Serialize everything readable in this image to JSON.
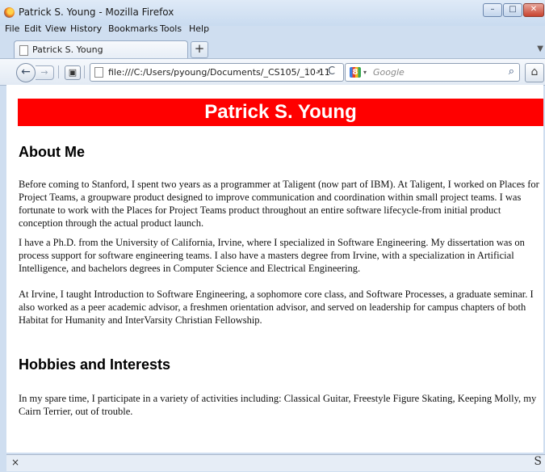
{
  "window": {
    "title": "Patrick S. Young - Mozilla Firefox",
    "controls": {
      "minimize": "–",
      "maximize": "□",
      "close": "✕"
    }
  },
  "menubar": [
    "File",
    "Edit",
    "View",
    "History",
    "Bookmarks",
    "Tools",
    "Help"
  ],
  "tab": {
    "label": "Patrick S. Young",
    "new_tab": "+",
    "scroll": "▼"
  },
  "nav": {
    "back": "←",
    "forward": "→",
    "panorama": "▣",
    "url": "file:///C:/Users/pyoung/Documents/_CS105/_10-11",
    "star": "☆",
    "dropdown": "▾",
    "reload": "C",
    "search_engine": "8",
    "search_dropdown": "▾",
    "search_placeholder": "Google",
    "search_button": "⌕",
    "home": "⌂"
  },
  "page": {
    "heading": "Patrick S. Young",
    "section1_title": "About Me",
    "para1": "Before coming to Stanford, I spent two years as a programmer at Taligent (now part of IBM). At Taligent, I worked on Places for Project Teams, a groupware product designed to improve communication and coordination within small project teams. I was fortunate to work with the Places for Project Teams product throughout an entire software lifecycle-from initial product conception through the actual product launch.",
    "para2": "I have a Ph.D. from the University of California, Irvine, where I specialized in Software Engineering. My dissertation was on process support for software engineering teams. I also have a masters degree from Irvine, with a specialization in Artificial Intelligence, and bachelors degrees in Computer Science and Electrical Engineering.",
    "para3": "At Irvine, I taught Introduction to Software Engineering, a sophomore core class, and Software Processes, a graduate seminar. I also worked as a peer academic advisor, a freshmen orientation advisor, and served on leadership for campus chapters of both Habitat for Humanity and InterVarsity Christian Fellowship.",
    "section2_title": "Hobbies and Interests",
    "para4": "In my spare time, I participate in a variety of activities including: Classical Guitar, Freestyle Figure Skating, Keeping Molly, my Cairn Terrier, out of trouble."
  },
  "statusbar": {
    "close": "×",
    "right_icon": "S"
  }
}
